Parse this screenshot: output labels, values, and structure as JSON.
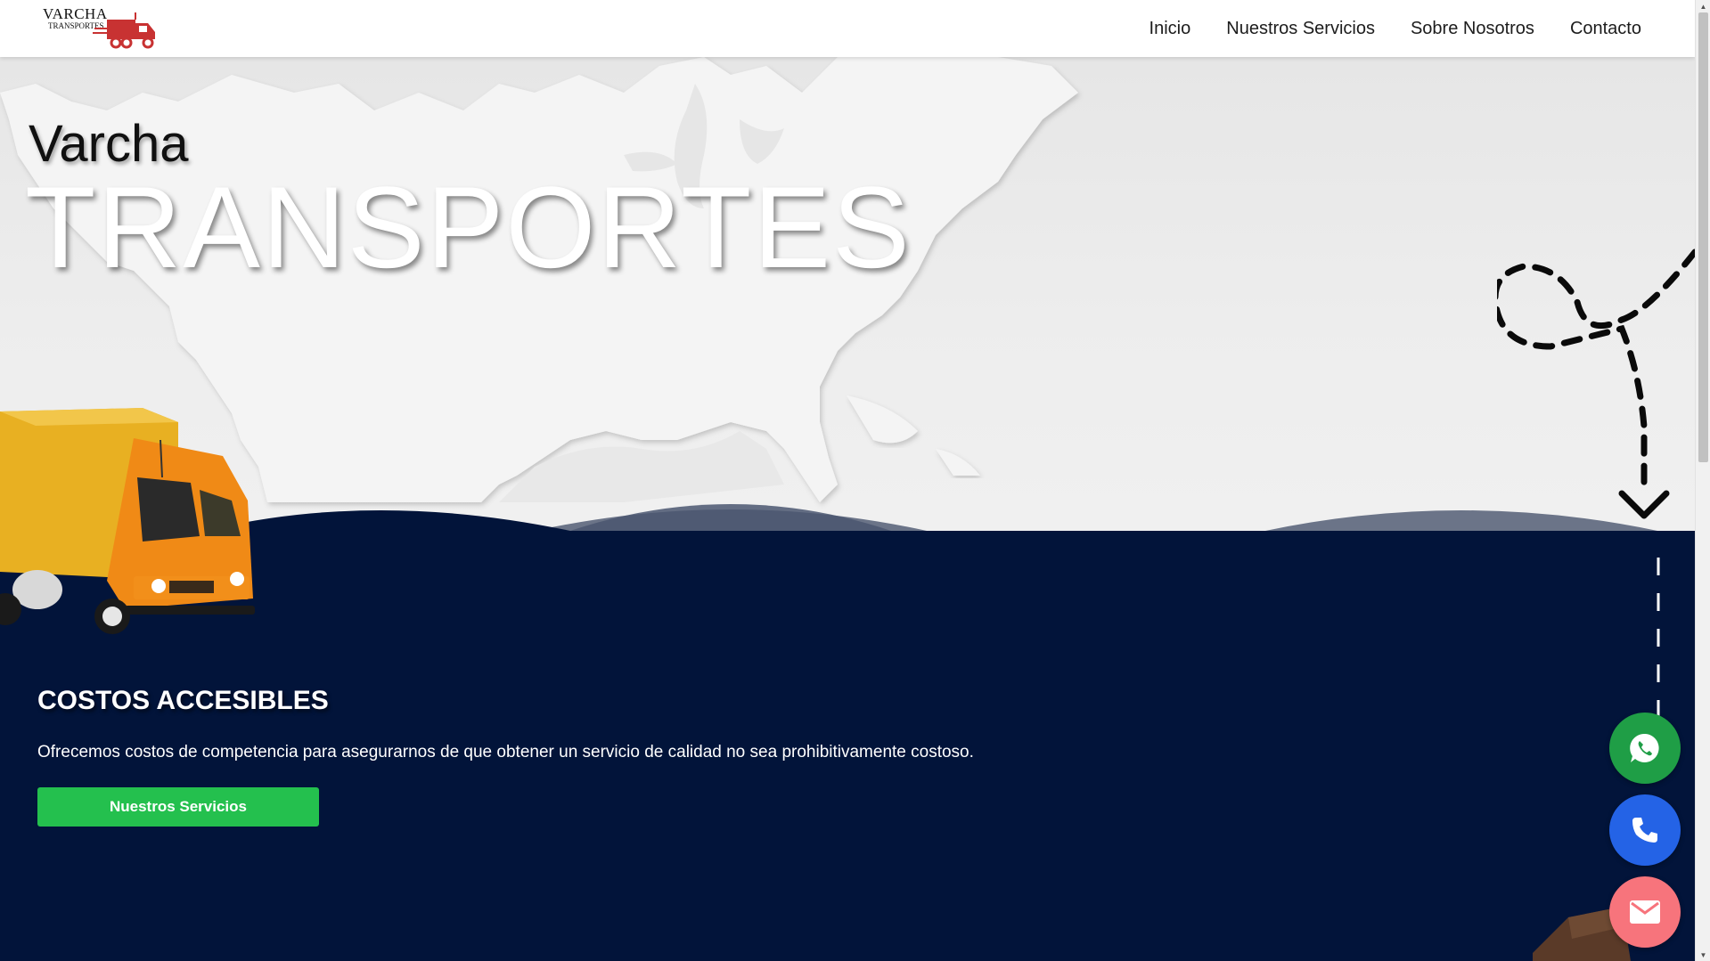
{
  "header": {
    "logo": {
      "line1": "VARCHA",
      "line2": "TRANSPORTES"
    },
    "nav": [
      {
        "label": "Inicio"
      },
      {
        "label": "Nuestros Servicios"
      },
      {
        "label": "Sobre Nosotros"
      },
      {
        "label": "Contacto"
      }
    ]
  },
  "hero": {
    "subtitle": "Varcha",
    "title": "TRANSPORTES"
  },
  "section": {
    "heading": "COSTOS ACCESIBLES",
    "description": "Ofrecemos costos de competencia para asegurarnos de que obtener un servicio de calidad no sea prohibitivamente costoso.",
    "button_label": "Nuestros Servicios"
  },
  "floating_buttons": [
    {
      "name": "whatsapp",
      "icon": "whatsapp-icon",
      "color": "#1f9e46"
    },
    {
      "name": "phone",
      "icon": "phone-icon",
      "color": "#2463e6"
    },
    {
      "name": "email",
      "icon": "mail-icon",
      "color": "#f7747c"
    }
  ],
  "colors": {
    "navy": "#02143a",
    "accent_green": "#24c04e",
    "header_bg": "#ffffff"
  }
}
